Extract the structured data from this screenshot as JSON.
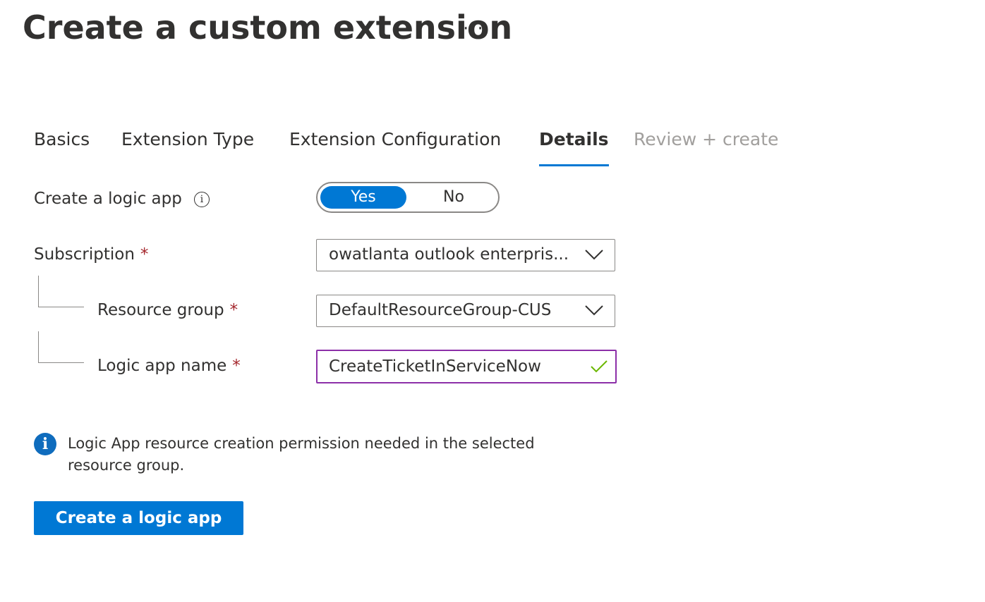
{
  "header": {
    "title": "Create a custom extension",
    "more_label": "···"
  },
  "tabs": [
    {
      "label": "Basics",
      "state": "normal"
    },
    {
      "label": "Extension Type",
      "state": "normal"
    },
    {
      "label": "Extension Configuration",
      "state": "normal"
    },
    {
      "label": "Details",
      "state": "active"
    },
    {
      "label": "Review + create",
      "state": "disabled"
    }
  ],
  "form": {
    "create_logic_app": {
      "label": "Create a logic app",
      "info_icon": "info-circle-icon",
      "options": [
        "Yes",
        "No"
      ],
      "selected": "Yes"
    },
    "subscription": {
      "label": "Subscription",
      "required_mark": "*",
      "value": "owatlanta outlook enterpris..."
    },
    "resource_group": {
      "label": "Resource group",
      "required_mark": "*",
      "value": "DefaultResourceGroup-CUS"
    },
    "logic_app_name": {
      "label": "Logic app name",
      "required_mark": "*",
      "value": "CreateTicketInServiceNow",
      "valid_icon": "checkmark-icon"
    }
  },
  "info_message": {
    "icon": "info-icon",
    "text": "Logic App resource creation permission needed in the selected resource group."
  },
  "actions": {
    "create_button_label": "Create a logic app"
  },
  "colors": {
    "accent": "#0078d4",
    "focus_border": "#8c2fa8",
    "required": "#a4262c",
    "valid_check": "#6bb700",
    "disabled_text": "#a19f9d"
  }
}
